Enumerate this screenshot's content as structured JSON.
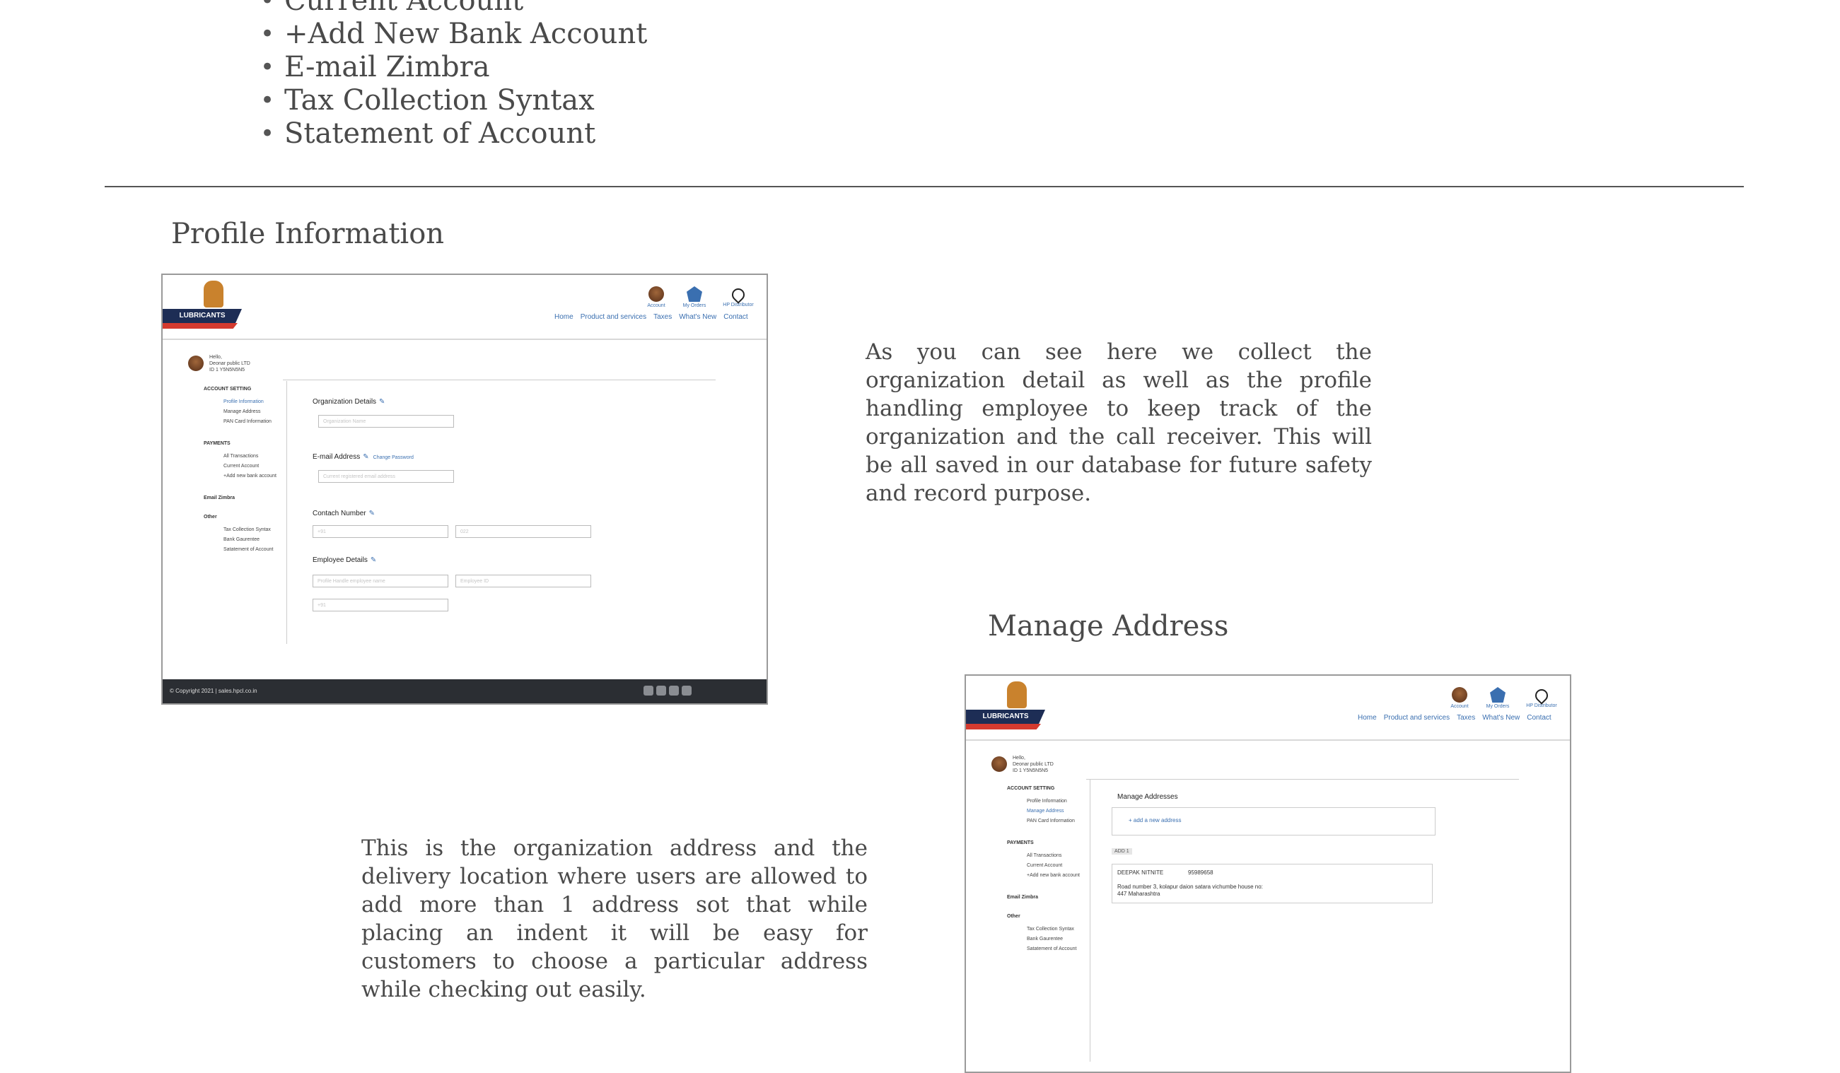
{
  "bullets": {
    "cut_item": "Current Account",
    "items": [
      "+Add New Bank Account",
      "E-mail Zimbra",
      "Tax Collection Syntax",
      "Statement of Account"
    ]
  },
  "profile_section": {
    "title": "Profile Information",
    "description": "As you can see here we collect the organization detail as well as the profile handling employee to keep track of the organization and the call receiver. This will be all saved in our database for future safety and record purpose."
  },
  "address_section": {
    "title": "Manage Address",
    "description": "This is the organization address and the delivery location where users are allowed to add more than 1 address sot that while placing an indent it will be easy for customers to choose a particular address while checking out easily."
  },
  "mock": {
    "logo_text": "LUBRICANTS",
    "header_icons": [
      "Account",
      "My Orders",
      "HP Distributor"
    ],
    "nav": [
      "Home",
      "Product and services",
      "Taxes",
      "What's New",
      "Contact"
    ],
    "greeting": "Hello,",
    "org_name": "Deonar public LTD",
    "user_id": "ID 1 Y5N5N5N5",
    "sidebar": {
      "account_setting": "ACCOUNT SETTING",
      "account_items": [
        "Profile Information",
        "Manage Address",
        "PAN Card Information"
      ],
      "payments": "PAYMENTS",
      "payment_items": [
        "All Transactions",
        "Current Account",
        "+Add new bank account"
      ],
      "email": "Email Zimbra",
      "other": "Other",
      "other_items": [
        "Tax Collection Syntax",
        "Bank Gaurentee",
        "Satatement of Account"
      ]
    },
    "profile_form": {
      "org_details": "Organization Details",
      "org_placeholder": "Organization Name",
      "email_label": "E-mail Address",
      "change_password": "Change Password",
      "email_placeholder": "Current registered email address",
      "contact_label": "Contach Number",
      "contact_ph1": "+91",
      "contact_ph2": "022",
      "employee_label": "Employee Details",
      "employee_ph1": "Profile Handle employee name",
      "employee_ph2": "Employee ID",
      "employee_ph3": "+91"
    },
    "footer": "© Copyright 2021 | sales.hpcl.co.in",
    "address_page": {
      "title": "Manage Addresses",
      "add_new": "+ add a new address",
      "tag": "ADD 1",
      "name": "DEEPAK NITNITE",
      "phone": "95989658",
      "address_line1": "Road number 3, kolapur daion satara vichumbe house no:",
      "address_line2": "447 Maharashtra"
    }
  }
}
